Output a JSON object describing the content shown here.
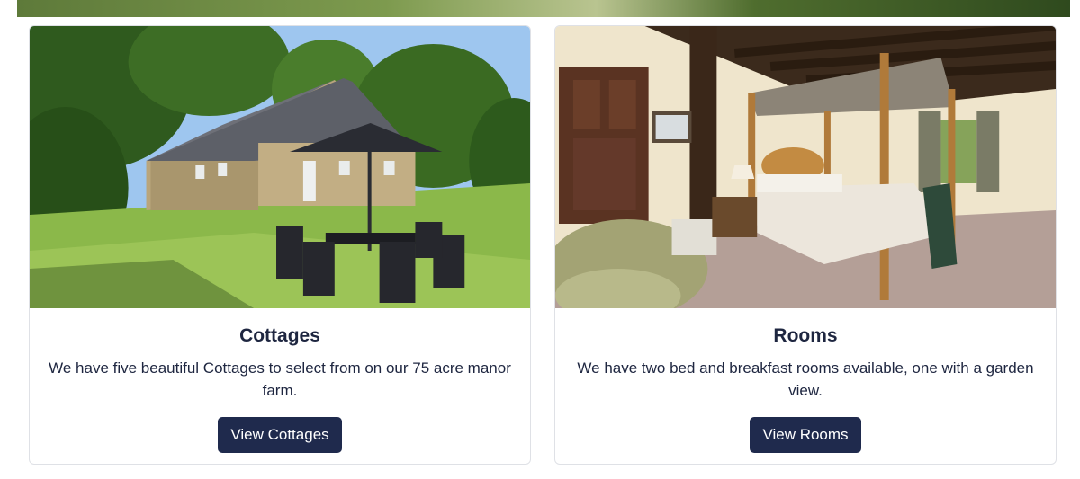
{
  "cards": [
    {
      "title": "Cottages",
      "description": "We have five beautiful Cottages to select from on our 75 acre manor farm.",
      "button_label": "View Cottages"
    },
    {
      "title": "Rooms",
      "description": "We have two bed and breakfast rooms available, one with a garden view.",
      "button_label": "View Rooms"
    }
  ],
  "colors": {
    "button_bg": "#1f2a4d",
    "heading_text": "#1e2640",
    "card_border": "#dfe1e6"
  }
}
